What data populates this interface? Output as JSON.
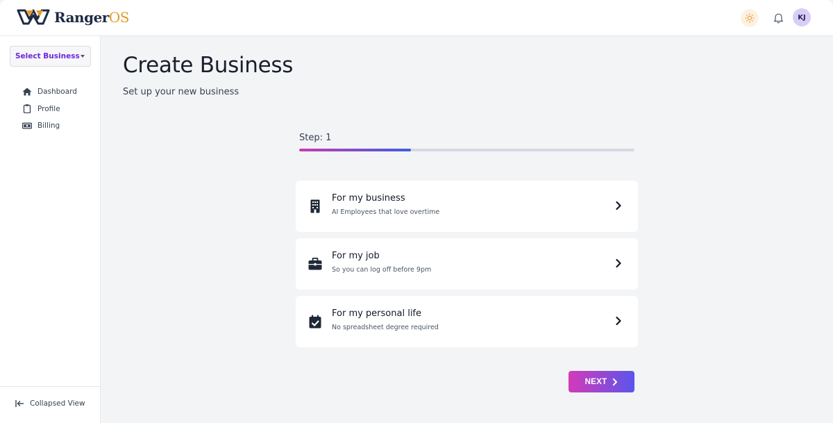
{
  "app": {
    "brand_name": "Ranger",
    "brand_suffix": "OS"
  },
  "header": {
    "avatar_initials": "KJ"
  },
  "sidebar": {
    "business_select": "Select Business",
    "items": [
      {
        "label": "Dashboard",
        "icon": "home-icon"
      },
      {
        "label": "Profile",
        "icon": "clipboard-icon"
      },
      {
        "label": "Billing",
        "icon": "money-icon"
      }
    ],
    "collapse_label": "Collapsed View"
  },
  "main": {
    "title": "Create Business",
    "subtitle": "Set up your new business",
    "step_label": "Step: 1",
    "progress_fraction": 0.333,
    "options": [
      {
        "title": "For my business",
        "description": "AI Employees that love overtime",
        "icon": "building-icon"
      },
      {
        "title": "For my job",
        "description": "So you can log off before 9pm",
        "icon": "briefcase-icon"
      },
      {
        "title": "For my personal life",
        "description": "No spreadsheet degree required",
        "icon": "calendar-check-icon"
      }
    ],
    "next_label": "NEXT"
  },
  "colors": {
    "accent_purple": "#6d28d9",
    "gradient_start": "#d33ab8",
    "gradient_end": "#5b55ec",
    "logo_navy": "#1f2a44",
    "logo_orange": "#e39b2c"
  }
}
